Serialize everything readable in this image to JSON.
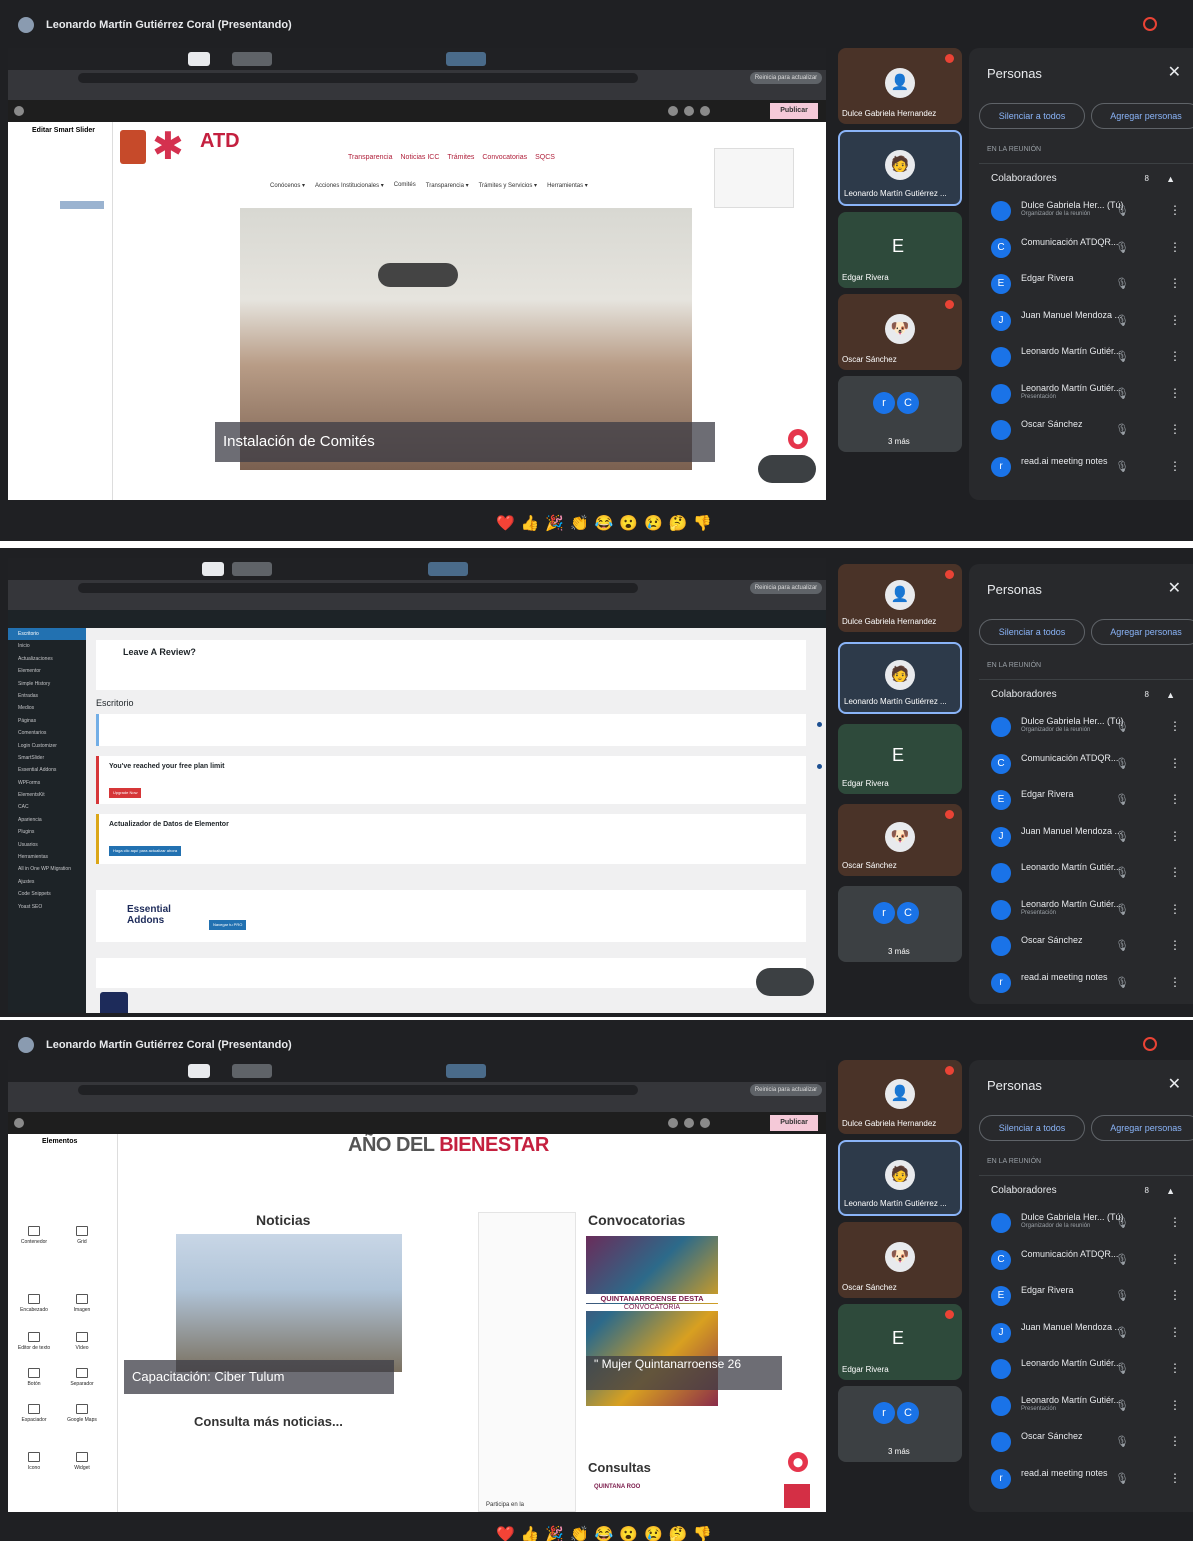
{
  "presenter_banner": "Leonardo Martín Gutiérrez Coral (Presentando)",
  "reactions": "❤️👍🎉👏😂😮😢🤔👎",
  "meet": {
    "tiles": [
      {
        "name": "Dulce Gabriela Hernandez"
      },
      {
        "name": "Leonardo Martín Gutiérrez ..."
      },
      {
        "name": "Edgar Rivera",
        "initial": "E"
      },
      {
        "name": "Oscar Sánchez"
      },
      {
        "name": "3 más",
        "initials": [
          "r",
          "C"
        ]
      }
    ],
    "people_panel": {
      "title": "Personas",
      "mute_all": "Silenciar a todos",
      "add_people": "Agregar personas",
      "section": "EN LA REUNIÓN",
      "collaborators": "Colaboradores",
      "count": "8",
      "list": [
        {
          "name": "Dulce Gabriela Her... (Tú)",
          "sub": "Organizador de la reunión",
          "initial": ""
        },
        {
          "name": "Comunicación ATDQR...",
          "sub": "",
          "initial": "C"
        },
        {
          "name": "Edgar Rivera",
          "sub": "",
          "initial": "E"
        },
        {
          "name": "Juan Manuel Mendoza ...",
          "sub": "",
          "initial": "J"
        },
        {
          "name": "Leonardo Martín Gutiér...",
          "sub": "",
          "initial": ""
        },
        {
          "name": "Leonardo Martín Gutiér...",
          "sub": "Presentación",
          "initial": ""
        },
        {
          "name": "Oscar Sánchez",
          "sub": "",
          "initial": ""
        },
        {
          "name": "read.ai meeting notes",
          "sub": "",
          "initial": "r"
        }
      ]
    }
  },
  "browser": {
    "restart": "Reinicia para actualizar",
    "publish": "Publicar"
  },
  "screen1": {
    "editor_title": "Editar Smart Slider",
    "logo": "ATD",
    "top_nav": [
      "Transparencia",
      "Noticias ICC",
      "Trámites",
      "Convocatorias",
      "SQCS"
    ],
    "menu": [
      "Conócenos ▾",
      "Acciones Institucionales ▾",
      "Comités",
      "Transparencia ▾",
      "Trámites y Servicios ▾",
      "Herramientas ▾"
    ],
    "slide_caption": "Instalación de Comités"
  },
  "screen2": {
    "review_title": "Leave A Review?",
    "desk_title": "Escritorio",
    "notice_titles": [
      "You've reached your free plan limit",
      "Actualizador de Datos de Elementor"
    ],
    "btn_upgrade": "Upgrade Now",
    "btn_update": "Haga clic aquí para actualizar ahora",
    "essential": "Essential Addons",
    "btn_pro": "Navegar tu PRO",
    "sidebar": [
      "Escritorio",
      "Inicio",
      "Actualizaciones",
      "Elementor",
      "Simple History",
      "Entradas",
      "Medios",
      "Páginas",
      "Comentarios",
      "Login Customizer",
      "SmartSlider",
      "Essential Addons",
      "WPForms",
      "ElementsKit",
      "CAC",
      "Apariencia",
      "Plugins",
      "Usuarios",
      "Herramientas",
      "All in One WP Migration",
      "Ajustes",
      "Code Snippets",
      "Yoast SEO"
    ]
  },
  "screen3": {
    "year_banner_a": "AÑO DEL",
    "year_banner_b": "BIENESTAR",
    "elements_title": "Elementos",
    "noticias": "Noticias",
    "news_caption": "Capacitación: Ciber Tulum",
    "more_news": "Consulta más noticias...",
    "convocatorias": "Convocatorias",
    "convoc_header": "QUINTANARROENSE DESTA",
    "convoc_sub": "CONVOCATORIA",
    "convoc_caption": "\" Mujer Quintanarroense 26",
    "consultas": "Consultas",
    "quintana": "QUINTANA ROO",
    "participa": "Participa en la",
    "widgets": [
      "Contenedor",
      "Grid",
      "Encabezado",
      "Imagen",
      "Editor de texto",
      "Vídeo",
      "Botón",
      "Separador",
      "Espaciador",
      "Google Maps",
      "Icono",
      "Widget"
    ]
  }
}
